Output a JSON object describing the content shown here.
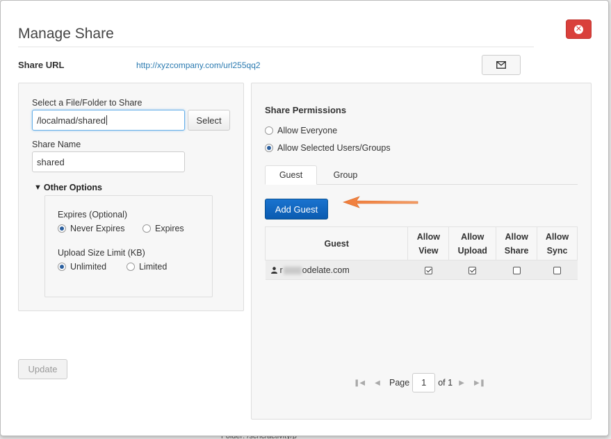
{
  "dialog": {
    "title": "Manage Share",
    "close_icon": "times-circle-icon"
  },
  "share_url": {
    "label": "Share URL",
    "url": "http://xyzcompany.com/url255qq2",
    "email_icon": "envelope-icon"
  },
  "left": {
    "file_label": "Select a File/Folder to Share",
    "file_value": "/localmad/shared",
    "select_label": "Select",
    "name_label": "Share Name",
    "name_value": "shared",
    "other_options": "Other Options",
    "expires_label": "Expires (Optional)",
    "never_expires": "Never Expires",
    "expires": "Expires",
    "upload_label": "Upload Size Limit (KB)",
    "unlimited": "Unlimited",
    "limited": "Limited",
    "update_label": "Update"
  },
  "permissions": {
    "title": "Share Permissions",
    "allow_everyone": "Allow Everyone",
    "allow_selected": "Allow Selected Users/Groups",
    "tabs": [
      "Guest",
      "Group"
    ],
    "add_guest": "Add Guest",
    "columns": [
      "Guest",
      "Allow",
      "View",
      "Allow",
      "Upload",
      "Allow",
      "Share",
      "Allow",
      "Sync"
    ],
    "row": {
      "guest_prefix": "r",
      "guest_suffix": "odelate.com",
      "view": true,
      "upload": true,
      "share": false,
      "sync": false
    }
  },
  "pager": {
    "page_label": "Page",
    "page_value": "1",
    "of_label": "of 1"
  },
  "backdrop": {
    "text": "Folder: /scnc/activity/p"
  },
  "colors": {
    "close_red": "#d9403b",
    "primary_blue": "#0a5bb0",
    "link_blue": "#2a7ab0",
    "arrow_orange": "#f07c3a"
  }
}
